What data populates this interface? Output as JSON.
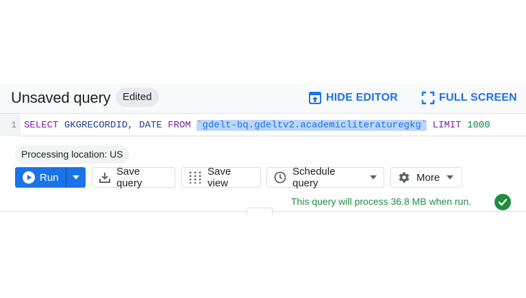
{
  "header": {
    "title": "Unsaved query",
    "badge": "Edited",
    "hide_editor_label": "HIDE EDITOR",
    "full_screen_label": "FULL SCREEN"
  },
  "editor": {
    "line_number": "1",
    "tokens": {
      "select": "SELECT",
      "col1": "GKGRECORDID,",
      "col2": "DATE",
      "from": "FROM",
      "table": "`gdelt-bq.gdeltv2.academicliteraturegkg`",
      "limit": "LIMIT",
      "limit_value": "1000"
    }
  },
  "processing_location": "Processing location: US",
  "toolbar": {
    "run_label": "Run",
    "save_query_label": "Save query",
    "save_view_label": "Save view",
    "schedule_query_label": "Schedule query",
    "more_label": "More"
  },
  "status": {
    "message": "This query will process 36.8 MB when run.",
    "state_color": "#1e8e3e"
  },
  "colors": {
    "accent": "#1a73e8",
    "keyword": "#7b1fa2",
    "identifier": "#1a3d8f",
    "number": "#0b8043",
    "selection": "#bcd6fb"
  },
  "icons": [
    "hide-editor-icon",
    "full-screen-icon",
    "play-icon",
    "dropdown-arrow-icon",
    "download-icon",
    "dots-grid-icon",
    "clock-icon",
    "gear-icon",
    "check-circle-icon"
  ]
}
